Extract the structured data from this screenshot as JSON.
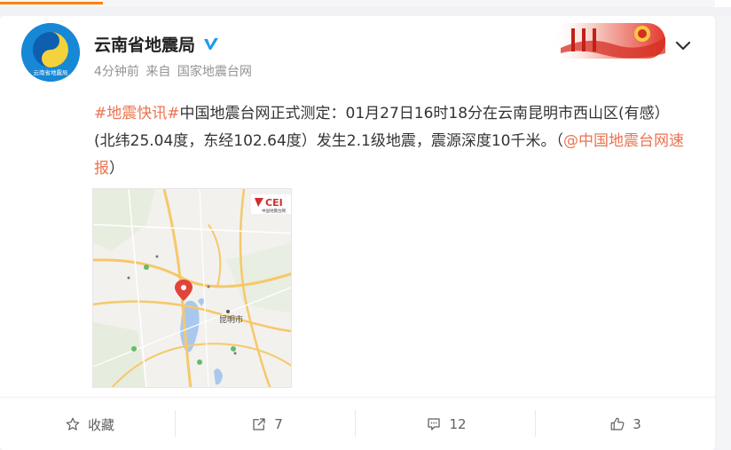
{
  "user": {
    "name": "云南省地震局",
    "avatar_text": "云南省地震局",
    "verified_icon": "verified-v-icon"
  },
  "meta": {
    "time": "4分钟前",
    "source_prefix": "来自",
    "source": "国家地震台网"
  },
  "post": {
    "tag": "#地震快讯#",
    "body": "中国地震台网正式测定：01月27日16时18分在云南昆明市西山区(有感）(北纬25.04度，东经102.64度）发生2.1级地震，震源深度10千米。（",
    "mention": "@中国地震台网速报",
    "tail": "）"
  },
  "map": {
    "logo": "CEI",
    "logo_sub": "中国地震台网",
    "city": "昆明市"
  },
  "actions": {
    "favorite_label": "收藏",
    "repost_count": "7",
    "comment_count": "12",
    "like_count": "3"
  },
  "colors": {
    "accent": "#ff8200",
    "link": "#eb7350",
    "verified": "#1d9bf0"
  }
}
